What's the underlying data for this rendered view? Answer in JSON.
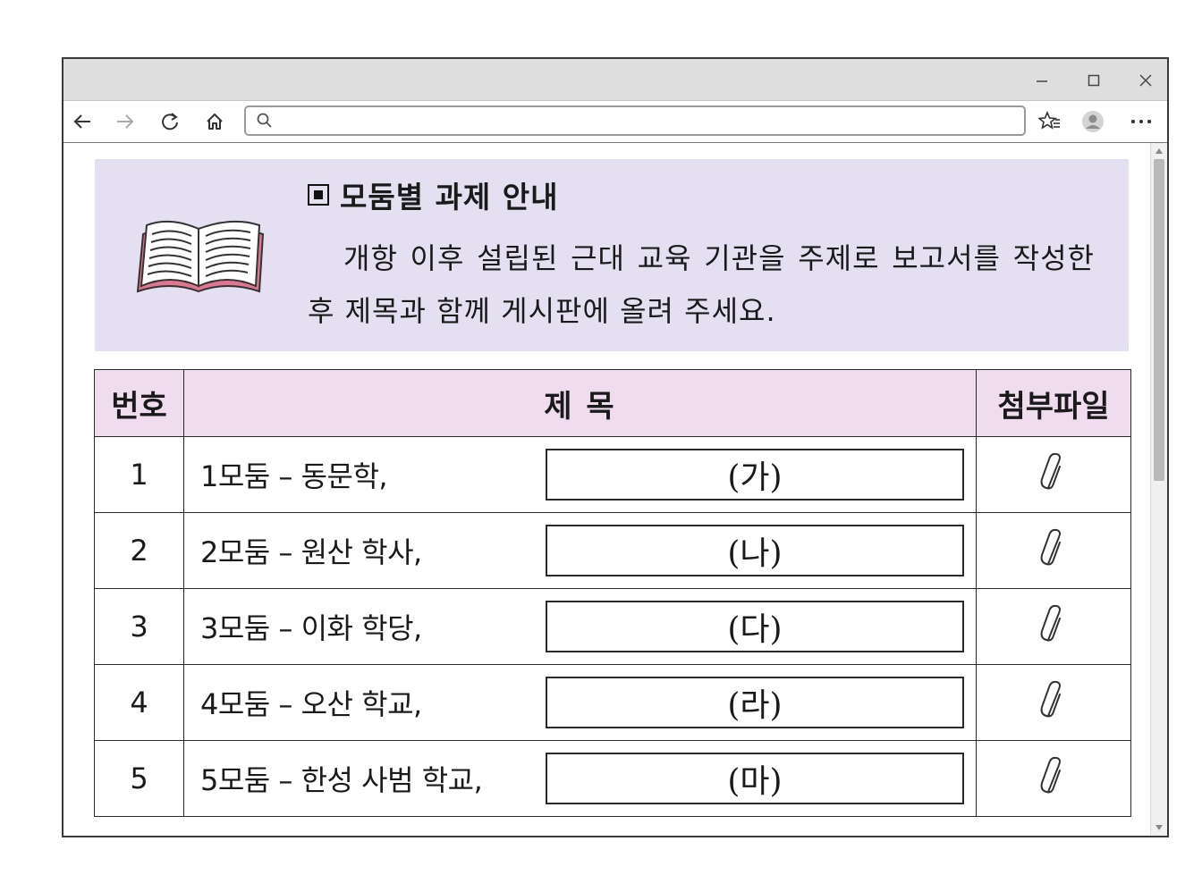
{
  "browser": {
    "address": {
      "value": "",
      "placeholder": ""
    },
    "window_controls": [
      "minimize-icon",
      "maximize-icon",
      "close-icon"
    ],
    "nav_icons": [
      "back-arrow-icon",
      "forward-arrow-icon",
      "refresh-icon",
      "home-icon"
    ],
    "toolbar_icons": [
      "favorites-star-icon",
      "profile-icon",
      "more-dots-icon"
    ]
  },
  "notice": {
    "title": "모둠별 과제 안내",
    "body": "개항 이후 설립된 근대 교육 기관을 주제로 보고서를 작성한 후 제목과 함께 게시판에 올려 주세요."
  },
  "table": {
    "headers": {
      "number": "번호",
      "title": "제 목",
      "attachment": "첨부파일"
    },
    "rows": [
      {
        "number": "1",
        "title": "1모둠 – 동문학,",
        "answer": "(가)"
      },
      {
        "number": "2",
        "title": "2모둠 – 원산 학사,",
        "answer": "(나)"
      },
      {
        "number": "3",
        "title": "3모둠 – 이화 학당,",
        "answer": "(다)"
      },
      {
        "number": "4",
        "title": "4모둠 – 오산 학교,",
        "answer": "(라)"
      },
      {
        "number": "5",
        "title": "5모둠 – 한성 사범 학교,",
        "answer": "(마)"
      }
    ]
  },
  "colors": {
    "notice_bg": "#e4e0f2",
    "header_bg": "#f0dcef",
    "book_cover": "#e07590"
  }
}
